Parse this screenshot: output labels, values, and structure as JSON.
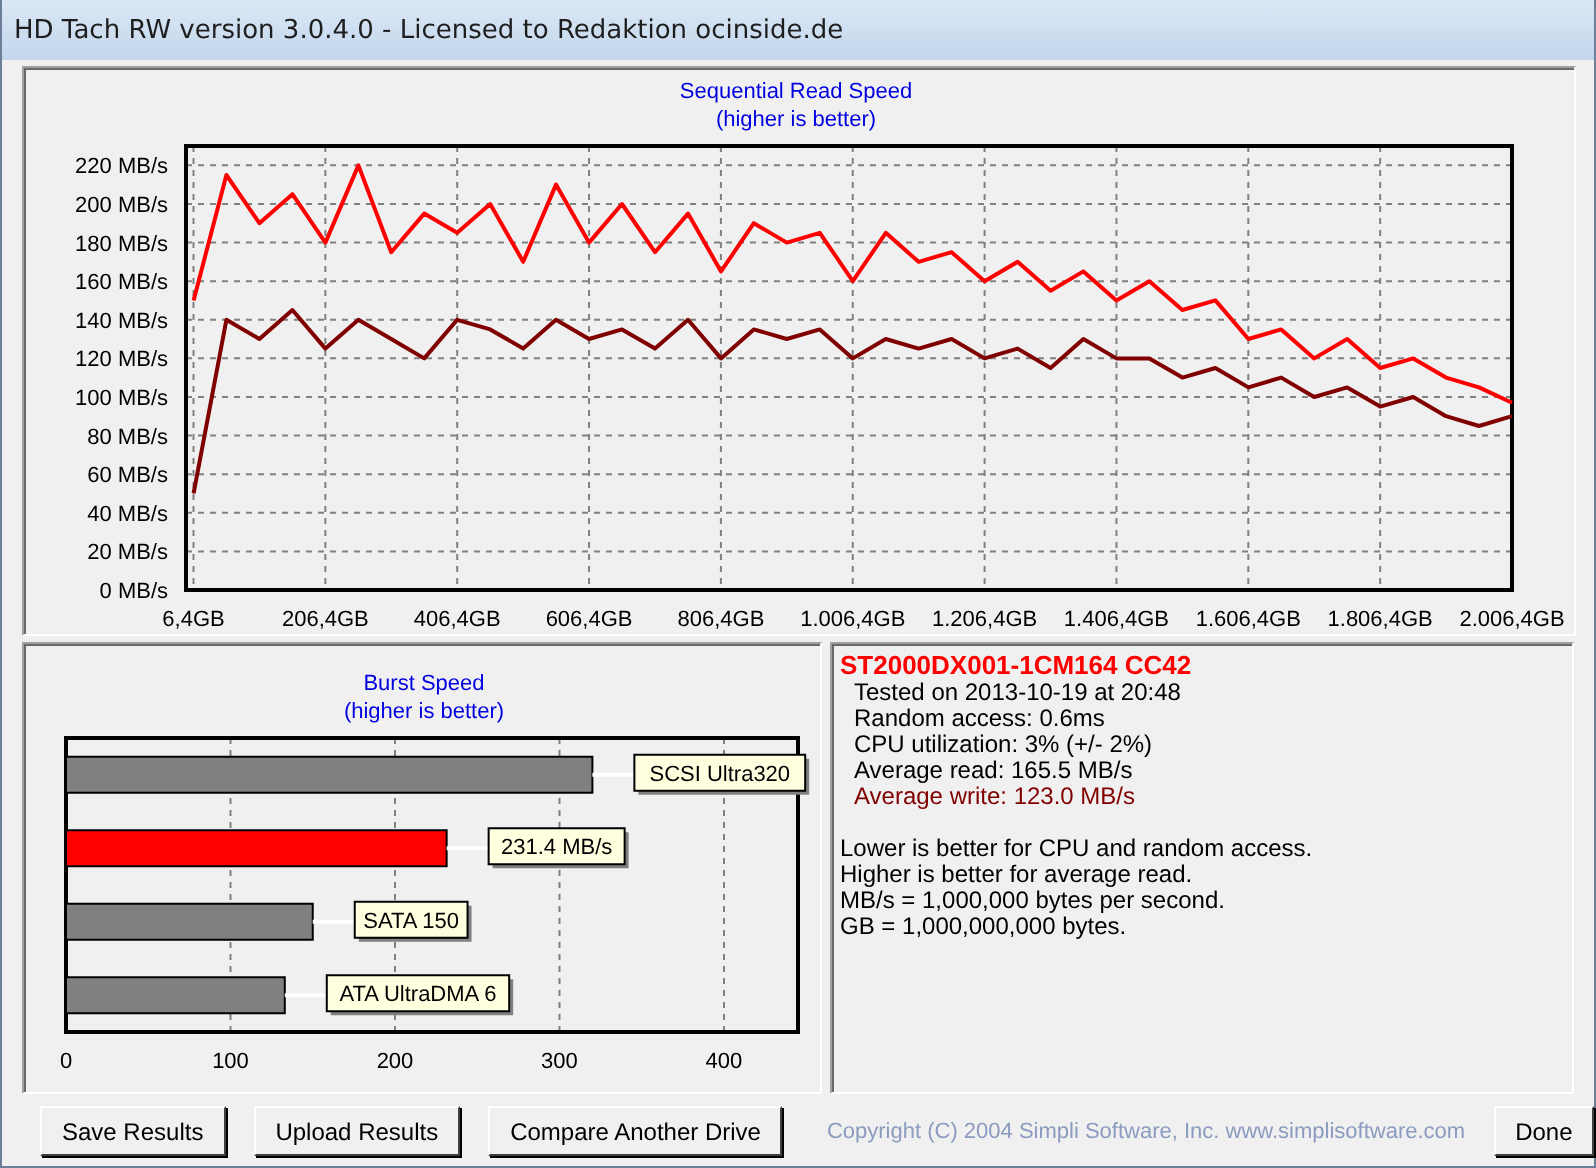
{
  "window": {
    "title": "HD Tach RW version 3.0.4.0 - Licensed to Redaktion ocinside.de"
  },
  "read_chart": {
    "subtitle": "(higher is better)",
    "chart_data": {
      "type": "line",
      "title": "Sequential Read Speed",
      "x": [
        6.4,
        56.4,
        106.4,
        156.4,
        206.4,
        256.4,
        306.4,
        356.4,
        406.4,
        456.4,
        506.4,
        556.4,
        606.4,
        656.4,
        706.4,
        756.4,
        806.4,
        856.4,
        906.4,
        956.4,
        1006.4,
        1056.4,
        1106.4,
        1156.4,
        1206.4,
        1256.4,
        1306.4,
        1356.4,
        1406.4,
        1456.4,
        1506.4,
        1556.4,
        1606.4,
        1656.4,
        1706.4,
        1756.4,
        1806.4,
        1856.4,
        1906.4,
        1956.4,
        2006.4
      ],
      "series": [
        {
          "color": "#ff0000",
          "values": [
            150,
            215,
            190,
            205,
            180,
            220,
            175,
            195,
            185,
            200,
            170,
            210,
            180,
            200,
            175,
            195,
            165,
            190,
            180,
            185,
            160,
            185,
            170,
            175,
            160,
            170,
            155,
            165,
            150,
            160,
            145,
            150,
            130,
            135,
            120,
            130,
            115,
            120,
            110,
            105,
            97
          ]
        },
        {
          "color": "#800000",
          "values": [
            50,
            140,
            130,
            145,
            125,
            140,
            130,
            120,
            140,
            135,
            125,
            140,
            130,
            135,
            125,
            140,
            120,
            135,
            130,
            135,
            120,
            130,
            125,
            130,
            120,
            125,
            115,
            130,
            120,
            120,
            110,
            115,
            105,
            110,
            100,
            105,
            95,
            100,
            90,
            85,
            90
          ]
        }
      ],
      "xlim": [
        -5,
        2006.4
      ],
      "ylim": [
        0,
        230
      ],
      "grid": true,
      "xticks": [
        {
          "value": 6.4,
          "label": "6,4GB"
        },
        {
          "value": 206.4,
          "label": "206,4GB"
        },
        {
          "value": 406.4,
          "label": "406,4GB"
        },
        {
          "value": 606.4,
          "label": "606,4GB"
        },
        {
          "value": 806.4,
          "label": "806,4GB"
        },
        {
          "value": 1006.4,
          "label": "1.006,4GB"
        },
        {
          "value": 1206.4,
          "label": "1.206,4GB"
        },
        {
          "value": 1406.4,
          "label": "1.406,4GB"
        },
        {
          "value": 1606.4,
          "label": "1.606,4GB"
        },
        {
          "value": 1806.4,
          "label": "1.806,4GB"
        },
        {
          "value": 2006.4,
          "label": "2.006,4GB"
        }
      ],
      "yticks": [
        {
          "value": 0,
          "label": "0 MB/s"
        },
        {
          "value": 20,
          "label": "20 MB/s"
        },
        {
          "value": 40,
          "label": "40 MB/s"
        },
        {
          "value": 60,
          "label": "60 MB/s"
        },
        {
          "value": 80,
          "label": "80 MB/s"
        },
        {
          "value": 100,
          "label": "100 MB/s"
        },
        {
          "value": 120,
          "label": "120 MB/s"
        },
        {
          "value": 140,
          "label": "140 MB/s"
        },
        {
          "value": 160,
          "label": "160 MB/s"
        },
        {
          "value": 180,
          "label": "180 MB/s"
        },
        {
          "value": 200,
          "label": "200 MB/s"
        },
        {
          "value": 220,
          "label": "220 MB/s"
        }
      ]
    }
  },
  "burst_chart": {
    "subtitle": "(higher is better)",
    "chart_data": {
      "type": "bar",
      "orientation": "horizontal",
      "stacked": true,
      "title": "Burst Speed",
      "categories": [
        "SCSI Ultra320",
        "231.4 MB/s",
        "SATA 150",
        "ATA UltraDMA 6"
      ],
      "series": [
        {
          "color": "#808080",
          "values": [
            320,
            null,
            150,
            133
          ]
        },
        {
          "color": "#ff0000",
          "values": [
            null,
            231.4,
            null,
            null
          ]
        }
      ],
      "xlim": [
        0,
        445
      ],
      "grid": true,
      "xticks": [
        0,
        100,
        200,
        300,
        400
      ]
    }
  },
  "info": {
    "drive": "ST2000DX001-1CM164 CC42",
    "lines": [
      {
        "text": "Tested on 2013-10-19 at 20:48",
        "color": "#000000"
      },
      {
        "text": "Random access: 0.6ms",
        "color": "#000000"
      },
      {
        "text": "CPU utilization: 3% (+/- 2%)",
        "color": "#000000"
      },
      {
        "text": "Average read: 165.5 MB/s",
        "color": "#000000"
      },
      {
        "text": "Average write: 123.0 MB/s",
        "color": "#800000"
      }
    ],
    "notes": [
      "Lower is better for CPU and random access.",
      "Higher is better for average read.",
      "MB/s = 1,000,000 bytes per second.",
      "GB = 1,000,000,000 bytes."
    ]
  },
  "buttons": [
    {
      "label": "Save Results"
    },
    {
      "label": "Upload Results"
    },
    {
      "label": "Compare Another Drive"
    }
  ],
  "copyright": "Copyright (C) 2004 Simpli Software, Inc. www.simplisoftware.com",
  "done_button": {
    "label": "Done"
  }
}
